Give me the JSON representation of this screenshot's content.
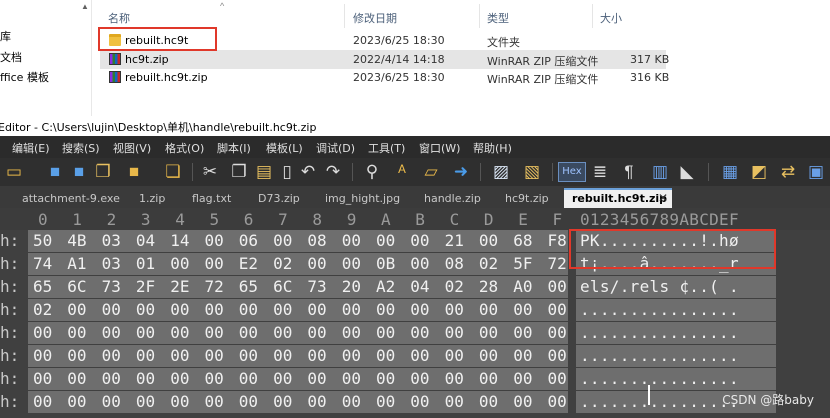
{
  "explorer": {
    "left_items": [
      "库",
      "文档",
      "ffice 模板"
    ],
    "columns": {
      "name": "名称",
      "modified": "修改日期",
      "type": "类型",
      "size": "大小"
    },
    "files": [
      {
        "name": "rebuilt.hc9t",
        "modified": "2023/6/25 18:30",
        "type": "文件夹",
        "size": "",
        "icon": "folder-icon"
      },
      {
        "name": "hc9t.zip",
        "modified": "2022/4/14 14:18",
        "type": "WinRAR ZIP 压缩文件",
        "size": "317 KB",
        "icon": "winrar-zip-icon"
      },
      {
        "name": "rebuilt.hc9t.zip",
        "modified": "2023/6/25 18:30",
        "type": "WinRAR ZIP 压缩文件",
        "size": "316 KB",
        "icon": "winrar-zip-icon"
      }
    ]
  },
  "editor": {
    "title": "Editor - C:\\Users\\lujin\\Desktop\\单机\\handle\\rebuilt.hc9t.zip",
    "menu": [
      "编辑(E)",
      "搜索(S)",
      "视图(V)",
      "格式(O)",
      "脚本(I)",
      "模板(L)",
      "调试(D)",
      "工具(T)",
      "窗口(W)",
      "帮助(H)"
    ],
    "toolbar_hex": "Hex",
    "tabs": [
      "attachment-9.exe",
      "1.zip",
      "flag.txt",
      "D73.zip",
      "img_hight.jpg",
      "handle.zip",
      "hc9t.zip"
    ],
    "active_tab": "rebuilt.hc9t.zip",
    "column_headers": [
      "0",
      "1",
      "2",
      "3",
      "4",
      "5",
      "6",
      "7",
      "8",
      "9",
      "A",
      "B",
      "C",
      "D",
      "E",
      "F"
    ],
    "ascii_header": "0123456789ABCDEF",
    "rows": [
      {
        "addr": "h:",
        "bytes": [
          "50",
          "4B",
          "03",
          "04",
          "14",
          "00",
          "06",
          "00",
          "08",
          "00",
          "00",
          "00",
          "21",
          "00",
          "68",
          "F8"
        ],
        "ascii": "PK..........!.hø"
      },
      {
        "addr": "h:",
        "bytes": [
          "74",
          "A1",
          "03",
          "01",
          "00",
          "00",
          "E2",
          "02",
          "00",
          "00",
          "0B",
          "00",
          "08",
          "02",
          "5F",
          "72"
        ],
        "ascii": "t¡....â......._r"
      },
      {
        "addr": "h:",
        "bytes": [
          "65",
          "6C",
          "73",
          "2F",
          "2E",
          "72",
          "65",
          "6C",
          "73",
          "20",
          "A2",
          "04",
          "02",
          "28",
          "A0",
          "00"
        ],
        "ascii": "els/.rels ¢..( ."
      },
      {
        "addr": "h:",
        "bytes": [
          "02",
          "00",
          "00",
          "00",
          "00",
          "00",
          "00",
          "00",
          "00",
          "00",
          "00",
          "00",
          "00",
          "00",
          "00",
          "00"
        ],
        "ascii": "................"
      },
      {
        "addr": "h:",
        "bytes": [
          "00",
          "00",
          "00",
          "00",
          "00",
          "00",
          "00",
          "00",
          "00",
          "00",
          "00",
          "00",
          "00",
          "00",
          "00",
          "00"
        ],
        "ascii": "................"
      },
      {
        "addr": "h:",
        "bytes": [
          "00",
          "00",
          "00",
          "00",
          "00",
          "00",
          "00",
          "00",
          "00",
          "00",
          "00",
          "00",
          "00",
          "00",
          "00",
          "00"
        ],
        "ascii": "................"
      },
      {
        "addr": "h:",
        "bytes": [
          "00",
          "00",
          "00",
          "00",
          "00",
          "00",
          "00",
          "00",
          "00",
          "00",
          "00",
          "00",
          "00",
          "00",
          "00",
          "00"
        ],
        "ascii": "................"
      },
      {
        "addr": "h:",
        "bytes": [
          "00",
          "00",
          "00",
          "00",
          "00",
          "00",
          "00",
          "00",
          "00",
          "00",
          "00",
          "00",
          "00",
          "00",
          "00",
          "00"
        ],
        "ascii": "................"
      }
    ]
  },
  "watermark": "CSDN @路baby",
  "colors": {
    "highlight": "#e0382a",
    "hex_bg": "#6e6e6e",
    "editor_bg": "#404040"
  }
}
